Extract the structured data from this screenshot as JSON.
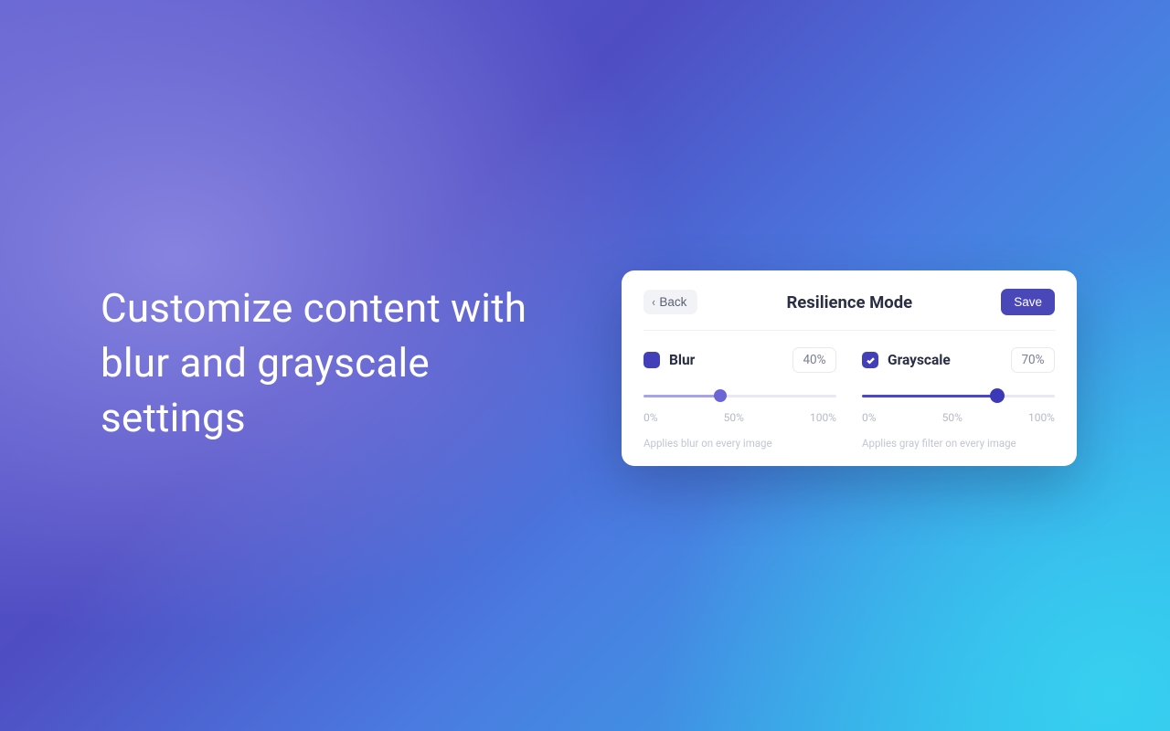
{
  "headline": "Customize content with blur and grayscale settings",
  "card": {
    "back_label": "Back",
    "title": "Resilience Mode",
    "save_label": "Save"
  },
  "blur": {
    "label": "Blur",
    "value_display": "40%",
    "value_percent": 40,
    "checked": false,
    "ticks": {
      "low": "0%",
      "mid": "50%",
      "high": "100%"
    },
    "helper": "Applies blur on every image"
  },
  "grayscale": {
    "label": "Grayscale",
    "value_display": "70%",
    "value_percent": 70,
    "checked": true,
    "ticks": {
      "low": "0%",
      "mid": "50%",
      "high": "100%"
    },
    "helper": "Applies gray filter on every image"
  }
}
